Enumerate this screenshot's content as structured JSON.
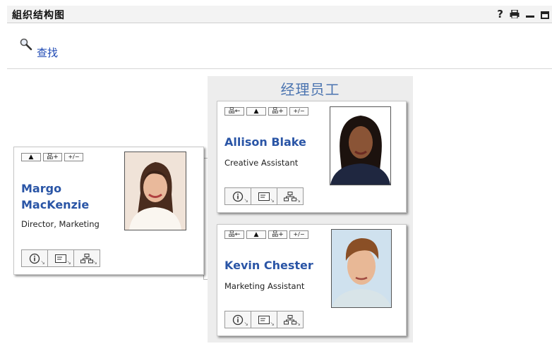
{
  "window": {
    "title": "組织结构图",
    "help_label": "?"
  },
  "search": {
    "label": "查找"
  },
  "panel": {
    "title": "经理员工"
  },
  "controls": {
    "up": "▲",
    "tree": "品+",
    "plus_minus": "+/−",
    "back": "品←"
  },
  "cards": [
    {
      "name_line1": "Margo",
      "name_line2": "MacKenzie",
      "title": "Director, Marketing"
    },
    {
      "name_line1": "Allison Blake",
      "name_line2": "",
      "title": "Creative Assistant"
    },
    {
      "name_line1": "Kevin Chester",
      "name_line2": "",
      "title": "Marketing Assistant"
    }
  ],
  "colors": {
    "accent": "#2a55a6",
    "link": "#1e49b4",
    "panel_title": "#4b74b0",
    "panel_bg": "#ededed"
  }
}
